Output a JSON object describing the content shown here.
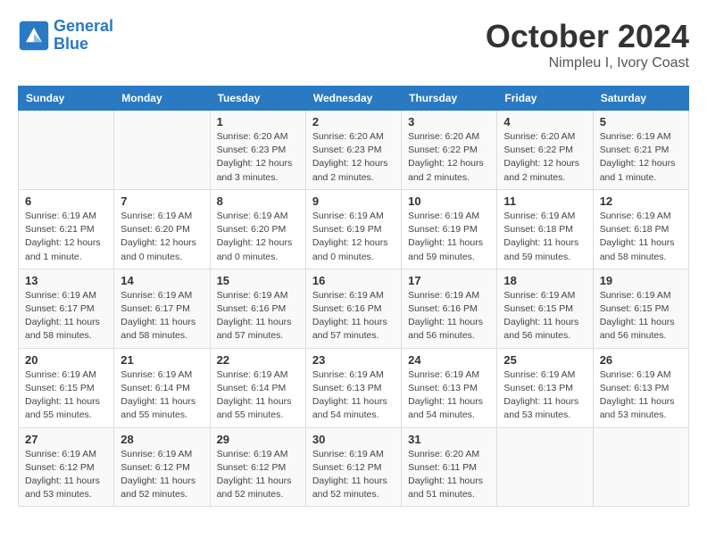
{
  "logo": {
    "text_general": "General",
    "text_blue": "Blue"
  },
  "title": "October 2024",
  "subtitle": "Nimpleu I, Ivory Coast",
  "header_color": "#2979c3",
  "days_of_week": [
    "Sunday",
    "Monday",
    "Tuesday",
    "Wednesday",
    "Thursday",
    "Friday",
    "Saturday"
  ],
  "weeks": [
    [
      {
        "day": "",
        "detail": ""
      },
      {
        "day": "",
        "detail": ""
      },
      {
        "day": "1",
        "detail": "Sunrise: 6:20 AM\nSunset: 6:23 PM\nDaylight: 12 hours and 3 minutes."
      },
      {
        "day": "2",
        "detail": "Sunrise: 6:20 AM\nSunset: 6:23 PM\nDaylight: 12 hours and 2 minutes."
      },
      {
        "day": "3",
        "detail": "Sunrise: 6:20 AM\nSunset: 6:22 PM\nDaylight: 12 hours and 2 minutes."
      },
      {
        "day": "4",
        "detail": "Sunrise: 6:20 AM\nSunset: 6:22 PM\nDaylight: 12 hours and 2 minutes."
      },
      {
        "day": "5",
        "detail": "Sunrise: 6:19 AM\nSunset: 6:21 PM\nDaylight: 12 hours and 1 minute."
      }
    ],
    [
      {
        "day": "6",
        "detail": "Sunrise: 6:19 AM\nSunset: 6:21 PM\nDaylight: 12 hours and 1 minute."
      },
      {
        "day": "7",
        "detail": "Sunrise: 6:19 AM\nSunset: 6:20 PM\nDaylight: 12 hours and 0 minutes."
      },
      {
        "day": "8",
        "detail": "Sunrise: 6:19 AM\nSunset: 6:20 PM\nDaylight: 12 hours and 0 minutes."
      },
      {
        "day": "9",
        "detail": "Sunrise: 6:19 AM\nSunset: 6:19 PM\nDaylight: 12 hours and 0 minutes."
      },
      {
        "day": "10",
        "detail": "Sunrise: 6:19 AM\nSunset: 6:19 PM\nDaylight: 11 hours and 59 minutes."
      },
      {
        "day": "11",
        "detail": "Sunrise: 6:19 AM\nSunset: 6:18 PM\nDaylight: 11 hours and 59 minutes."
      },
      {
        "day": "12",
        "detail": "Sunrise: 6:19 AM\nSunset: 6:18 PM\nDaylight: 11 hours and 58 minutes."
      }
    ],
    [
      {
        "day": "13",
        "detail": "Sunrise: 6:19 AM\nSunset: 6:17 PM\nDaylight: 11 hours and 58 minutes."
      },
      {
        "day": "14",
        "detail": "Sunrise: 6:19 AM\nSunset: 6:17 PM\nDaylight: 11 hours and 58 minutes."
      },
      {
        "day": "15",
        "detail": "Sunrise: 6:19 AM\nSunset: 6:16 PM\nDaylight: 11 hours and 57 minutes."
      },
      {
        "day": "16",
        "detail": "Sunrise: 6:19 AM\nSunset: 6:16 PM\nDaylight: 11 hours and 57 minutes."
      },
      {
        "day": "17",
        "detail": "Sunrise: 6:19 AM\nSunset: 6:16 PM\nDaylight: 11 hours and 56 minutes."
      },
      {
        "day": "18",
        "detail": "Sunrise: 6:19 AM\nSunset: 6:15 PM\nDaylight: 11 hours and 56 minutes."
      },
      {
        "day": "19",
        "detail": "Sunrise: 6:19 AM\nSunset: 6:15 PM\nDaylight: 11 hours and 56 minutes."
      }
    ],
    [
      {
        "day": "20",
        "detail": "Sunrise: 6:19 AM\nSunset: 6:15 PM\nDaylight: 11 hours and 55 minutes."
      },
      {
        "day": "21",
        "detail": "Sunrise: 6:19 AM\nSunset: 6:14 PM\nDaylight: 11 hours and 55 minutes."
      },
      {
        "day": "22",
        "detail": "Sunrise: 6:19 AM\nSunset: 6:14 PM\nDaylight: 11 hours and 55 minutes."
      },
      {
        "day": "23",
        "detail": "Sunrise: 6:19 AM\nSunset: 6:13 PM\nDaylight: 11 hours and 54 minutes."
      },
      {
        "day": "24",
        "detail": "Sunrise: 6:19 AM\nSunset: 6:13 PM\nDaylight: 11 hours and 54 minutes."
      },
      {
        "day": "25",
        "detail": "Sunrise: 6:19 AM\nSunset: 6:13 PM\nDaylight: 11 hours and 53 minutes."
      },
      {
        "day": "26",
        "detail": "Sunrise: 6:19 AM\nSunset: 6:13 PM\nDaylight: 11 hours and 53 minutes."
      }
    ],
    [
      {
        "day": "27",
        "detail": "Sunrise: 6:19 AM\nSunset: 6:12 PM\nDaylight: 11 hours and 53 minutes."
      },
      {
        "day": "28",
        "detail": "Sunrise: 6:19 AM\nSunset: 6:12 PM\nDaylight: 11 hours and 52 minutes."
      },
      {
        "day": "29",
        "detail": "Sunrise: 6:19 AM\nSunset: 6:12 PM\nDaylight: 11 hours and 52 minutes."
      },
      {
        "day": "30",
        "detail": "Sunrise: 6:19 AM\nSunset: 6:12 PM\nDaylight: 11 hours and 52 minutes."
      },
      {
        "day": "31",
        "detail": "Sunrise: 6:20 AM\nSunset: 6:11 PM\nDaylight: 11 hours and 51 minutes."
      },
      {
        "day": "",
        "detail": ""
      },
      {
        "day": "",
        "detail": ""
      }
    ]
  ]
}
